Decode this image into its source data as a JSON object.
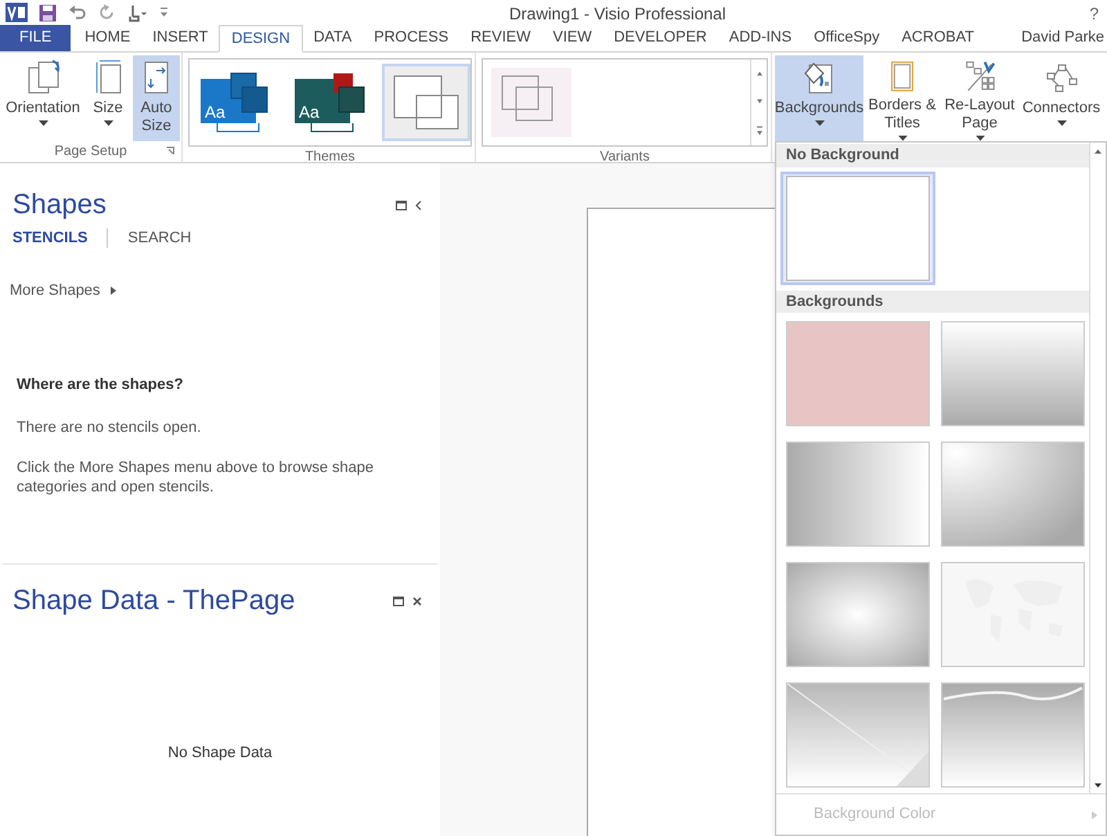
{
  "window": {
    "title": "Drawing1 - Visio Professional",
    "help": "?"
  },
  "tabs": [
    {
      "label": "FILE",
      "selected": false,
      "kind": "file"
    },
    {
      "label": "HOME",
      "selected": false,
      "kind": "tab"
    },
    {
      "label": "INSERT",
      "selected": false,
      "kind": "tab"
    },
    {
      "label": "DESIGN",
      "selected": true,
      "kind": "tab"
    },
    {
      "label": "DATA",
      "selected": false,
      "kind": "tab"
    },
    {
      "label": "PROCESS",
      "selected": false,
      "kind": "tab"
    },
    {
      "label": "REVIEW",
      "selected": false,
      "kind": "tab"
    },
    {
      "label": "VIEW",
      "selected": false,
      "kind": "tab"
    },
    {
      "label": "DEVELOPER",
      "selected": false,
      "kind": "tab"
    },
    {
      "label": "ADD-INS",
      "selected": false,
      "kind": "tab"
    },
    {
      "label": "OfficeSpy",
      "selected": false,
      "kind": "tab"
    },
    {
      "label": "ACROBAT",
      "selected": false,
      "kind": "tab"
    }
  ],
  "user": "David Parke",
  "ribbon": {
    "page_setup": {
      "label": "Page Setup",
      "buttons": [
        {
          "label": "Orientation",
          "kind": "orientation",
          "pressed": false,
          "has_menu": true
        },
        {
          "label": "Size",
          "kind": "size",
          "pressed": false,
          "has_menu": true
        },
        {
          "label": "Auto Size",
          "kind": "autosize",
          "pressed": true,
          "has_menu": false
        }
      ]
    },
    "themes": {
      "label": "Themes",
      "items": [
        {
          "kind": "blue",
          "caption": "Aa",
          "selected": false
        },
        {
          "kind": "green",
          "caption": "Aa",
          "selected": false
        },
        {
          "kind": "blank",
          "selected": true
        }
      ]
    },
    "variants": {
      "label": "Variants",
      "items": [
        {
          "kind": "outline",
          "selected": false
        }
      ]
    },
    "backgrounds": {
      "buttons": [
        {
          "label": "Backgrounds",
          "kind": "backgrounds",
          "pressed": true,
          "has_menu": true
        },
        {
          "label": "Borders & Titles",
          "kind": "borders",
          "pressed": false,
          "has_menu": true
        },
        {
          "label": "Re-Layout Page",
          "kind": "relayout",
          "pressed": false,
          "has_menu": true
        },
        {
          "label": "Connectors",
          "kind": "connectors",
          "pressed": false,
          "has_menu": true
        }
      ]
    }
  },
  "shapes_pane": {
    "title": "Shapes",
    "tabs": [
      {
        "label": "STENCILS",
        "selected": true
      },
      {
        "label": "SEARCH",
        "selected": false
      }
    ],
    "more_shapes": "More Shapes",
    "heading": "Where are the shapes?",
    "message": "There are no stencils open.",
    "hint": "Click the More Shapes menu above to browse shape categories and open stencils."
  },
  "shape_data_pane": {
    "title": "Shape Data - ThePage",
    "empty_text": "No Shape Data"
  },
  "backgrounds_menu": {
    "sections": [
      {
        "title": "No Background",
        "items": [
          {
            "kind": "blank",
            "selected": true
          }
        ]
      },
      {
        "title": "Backgrounds",
        "items": [
          {
            "kind": "pink",
            "selected": false
          },
          {
            "kind": "fade-down",
            "selected": false
          },
          {
            "kind": "fade-side",
            "selected": false
          },
          {
            "kind": "radial-corner",
            "selected": false
          },
          {
            "kind": "radial-center",
            "selected": false
          },
          {
            "kind": "world",
            "selected": false
          },
          {
            "kind": "diagonal",
            "selected": false
          },
          {
            "kind": "wave",
            "selected": false
          }
        ]
      }
    ],
    "footer": {
      "label": "Background Color",
      "disabled": true
    }
  }
}
